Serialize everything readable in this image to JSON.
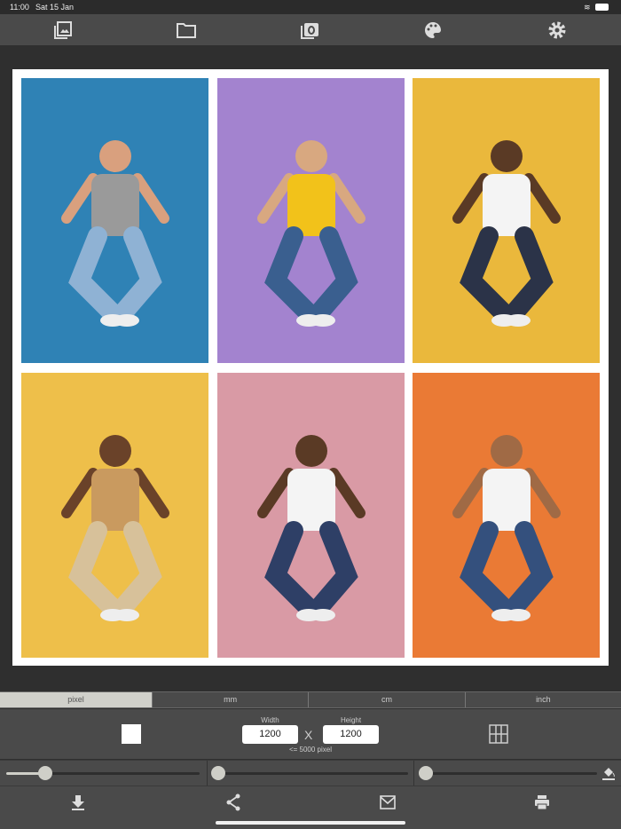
{
  "status": {
    "time": "11:00",
    "date": "Sat 15 Jan"
  },
  "toolbar": {
    "icons": [
      "photo-library-icon",
      "folder-icon",
      "camera-icon",
      "palette-icon",
      "gear-icon"
    ]
  },
  "collage": {
    "photos": [
      {
        "color": "#2f82b5",
        "shirt": "#9a9a9a",
        "pants": "#8fb2d4",
        "skin": "#d9a07e"
      },
      {
        "color": "#a383cf",
        "shirt": "#f2c21a",
        "pants": "#3a5f8f",
        "skin": "#d8a880"
      },
      {
        "color": "#eab83c",
        "shirt": "#f4f4f4",
        "pants": "#2b3348",
        "skin": "#5a3a25"
      },
      {
        "color": "#eebf4a",
        "shirt": "#c99a5f",
        "pants": "#d7c19a",
        "skin": "#6a4229"
      },
      {
        "color": "#d99aa5",
        "shirt": "#f4f4f4",
        "pants": "#2e3f66",
        "skin": "#5a3a25"
      },
      {
        "color": "#ea7a35",
        "shirt": "#f4f4f4",
        "pants": "#34507d",
        "skin": "#a06a45"
      }
    ]
  },
  "units": [
    "pixel",
    "mm",
    "cm",
    "inch"
  ],
  "active_unit": "pixel",
  "size": {
    "width_label": "Width",
    "height_label": "Height",
    "width": "1200",
    "height": "1200",
    "times": "X",
    "hint": "<= 5000 pixel"
  },
  "sliders": [
    0.2,
    0,
    0
  ],
  "colors": {
    "accent": "#cfcfc8",
    "panel": "#4a4a4a"
  }
}
